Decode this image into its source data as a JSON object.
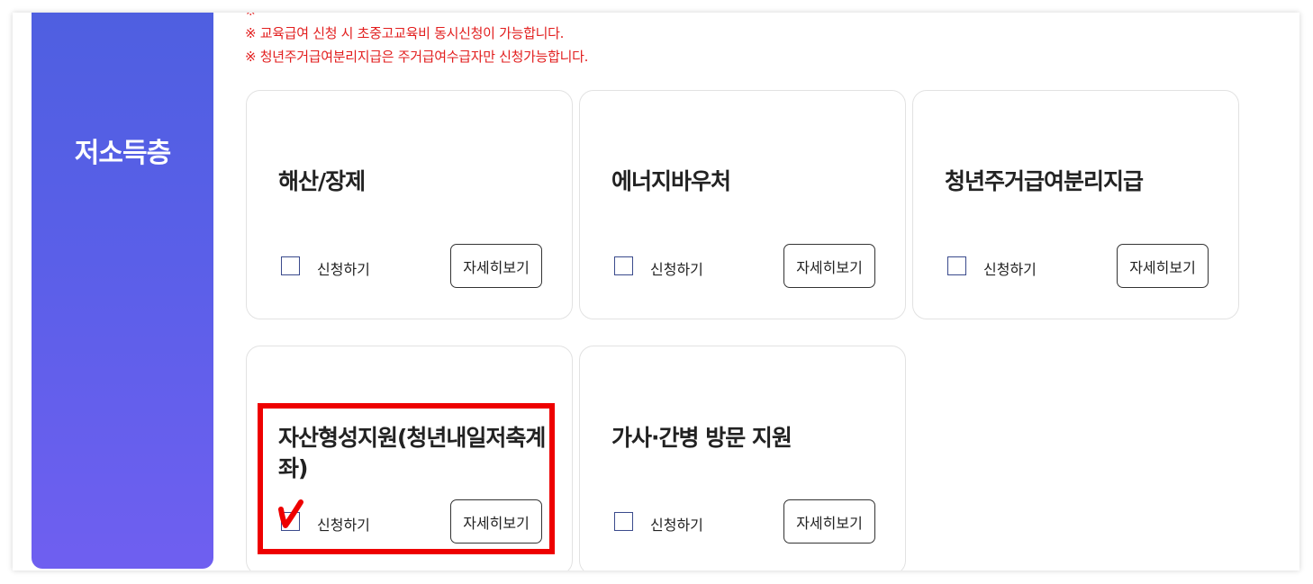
{
  "sidebar": {
    "title": "저소득층"
  },
  "notices": [
    "※ 교육급여 신청 시 초중고교육비 동시신청이 가능합니다.",
    "※ 청년주거급여분리지급은 주거급여수급자만 신청가능합니다."
  ],
  "cards": [
    {
      "title": "해산/장제",
      "checkbox_label": "신청하기",
      "detail_label": "자세히보기",
      "checked": false
    },
    {
      "title": "에너지바우처",
      "checkbox_label": "신청하기",
      "detail_label": "자세히보기",
      "checked": false
    },
    {
      "title": "청년주거급여분리지급",
      "checkbox_label": "신청하기",
      "detail_label": "자세히보기",
      "checked": false
    },
    {
      "title": "자산형성지원(청년내일저축계좌)",
      "checkbox_label": "신청하기",
      "detail_label": "자세히보기",
      "checked": true
    },
    {
      "title": "가사·간병 방문 지원",
      "checkbox_label": "신청하기",
      "detail_label": "자세히보기",
      "checked": false
    }
  ],
  "colors": {
    "accent_gradient_top": "#4e5fe0",
    "accent_gradient_bottom": "#6f5ff0",
    "notice": "#e21e1e",
    "highlight": "#ee0000"
  }
}
